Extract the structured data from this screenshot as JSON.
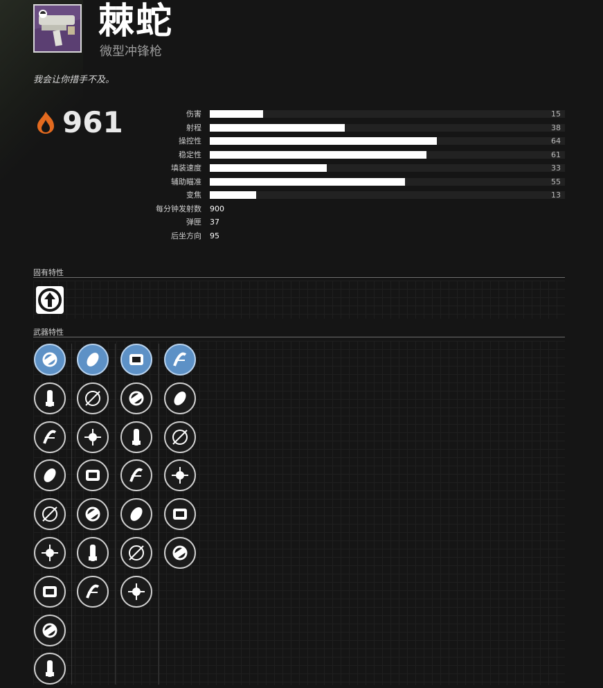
{
  "weapon": {
    "name": "棘蛇",
    "type": "微型冲锋枪",
    "flavor": "我会让你措手不及。",
    "power": "961",
    "power_icon": "flame-icon"
  },
  "stats": [
    {
      "label": "伤害",
      "value": "15",
      "fill": 15
    },
    {
      "label": "射程",
      "value": "38",
      "fill": 38
    },
    {
      "label": "操控性",
      "value": "64",
      "fill": 64
    },
    {
      "label": "稳定性",
      "value": "61",
      "fill": 61
    },
    {
      "label": "填装速度",
      "value": "33",
      "fill": 33
    },
    {
      "label": "辅助瞄准",
      "value": "55",
      "fill": 55
    },
    {
      "label": "变焦",
      "value": "13",
      "fill": 13
    }
  ],
  "plain_stats": [
    {
      "label": "每分钟发射数",
      "value": "900"
    },
    {
      "label": "弹匣",
      "value": "37"
    },
    {
      "label": "后坐方向",
      "value": "95"
    }
  ],
  "sections": {
    "intrinsic": "固有特性",
    "perks": "武器特性"
  },
  "perk_columns": [
    [
      "barrel-rifled-icon",
      "barrel-smallbore-icon",
      "barrel-fluted-icon",
      "barrel-hammer-icon",
      "barrel-corkscrew-icon",
      "barrel-extended-icon",
      "barrel-arrowhead-icon",
      "barrel-full-bore-icon",
      "barrel-polygonal-icon"
    ],
    [
      "magazine-round-icon",
      "magazine-ricochet-icon",
      "magazine-tactical-icon",
      "magazine-alloy-icon",
      "magazine-flared-icon",
      "magazine-accurized-icon",
      "magazine-extended-icon"
    ],
    [
      "trait-reload-icon",
      "trait-crosshair-icon",
      "trait-cycle-icon",
      "trait-triangle-icon",
      "trait-stack-icon",
      "trait-no-icon",
      "trait-bars-icon"
    ],
    [
      "trait-ball-icon",
      "trait-compass-icon",
      "trait-burst-icon",
      "trait-wheel-icon",
      "trait-x-icon",
      "trait-arrow-icon"
    ]
  ],
  "colors": {
    "accent_perk": "#5d91c6",
    "power_flame": "#e36a1f"
  }
}
